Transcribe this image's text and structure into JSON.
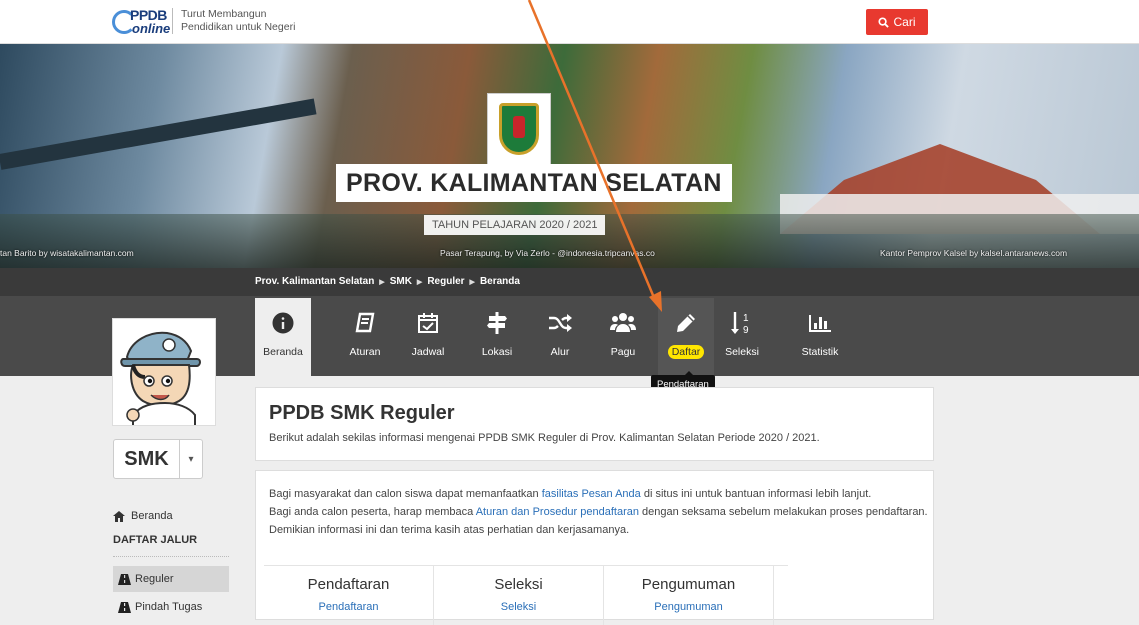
{
  "header": {
    "logo_top": "PPDB",
    "logo_bottom": "online",
    "tagline_1": "Turut Membangun",
    "tagline_2": "Pendidikan untuk Negeri",
    "search_label": "Cari"
  },
  "banner": {
    "title": "PROV. KALIMANTAN SELATAN",
    "subtitle": "TAHUN PELAJARAN 2020 / 2021",
    "credit_left": "tan Barito by wisatakalimantan.com",
    "credit_center": "Pasar Terapung, by Via Zerlo - @indonesia.tripcanvas.co",
    "credit_right": "Kantor Pemprov Kalsel by kalsel.antaranews.com"
  },
  "breadcrumb": [
    "Prov. Kalimantan Selatan",
    "SMK",
    "Reguler",
    "Beranda"
  ],
  "nav": [
    {
      "label": "Beranda",
      "icon": "info-icon"
    },
    {
      "label": "Aturan",
      "icon": "book-icon"
    },
    {
      "label": "Jadwal",
      "icon": "calendar-check-icon"
    },
    {
      "label": "Lokasi",
      "icon": "signpost-icon"
    },
    {
      "label": "Alur",
      "icon": "shuffle-icon"
    },
    {
      "label": "Pagu",
      "icon": "users-icon"
    },
    {
      "label": "Daftar",
      "icon": "pencil-icon"
    },
    {
      "label": "Seleksi",
      "icon": "sort-numeric-icon"
    },
    {
      "label": "Statistik",
      "icon": "bar-chart-icon"
    }
  ],
  "tooltip": "Pendaftaran",
  "sidebar": {
    "level": "SMK",
    "home": "Beranda",
    "section": "DAFTAR JALUR",
    "items": [
      "Reguler",
      "Pindah Tugas"
    ]
  },
  "intro": {
    "title": "PPDB SMK Reguler",
    "text": "Berikut adalah sekilas informasi mengenai PPDB SMK Reguler di Prov. Kalimantan Selatan Periode 2020 / 2021."
  },
  "info": {
    "l1a": "Bagi masyarakat dan calon siswa dapat memanfaatkan ",
    "l1link": "fasilitas Pesan Anda",
    "l1b": " di situs ini untuk bantuan informasi lebih lanjut.",
    "l2a": "Bagi anda calon peserta, harap membaca ",
    "l2link": "Aturan dan Prosedur pendaftaran",
    "l2b": " dengan seksama sebelum melakukan proses pendaftaran. Demikian informasi ini dan terima kasih atas perhatian dan kerjasamanya."
  },
  "tiles": [
    {
      "title": "Pendaftaran",
      "link": "Pendaftaran"
    },
    {
      "title": "Seleksi",
      "link": "Seleksi"
    },
    {
      "title": "Pengumuman",
      "link": "Pengumuman"
    }
  ],
  "colors": {
    "accent_red": "#e8392f",
    "highlight": "#ffe600",
    "arrow": "#e8722a",
    "link": "#2a6fb8"
  }
}
